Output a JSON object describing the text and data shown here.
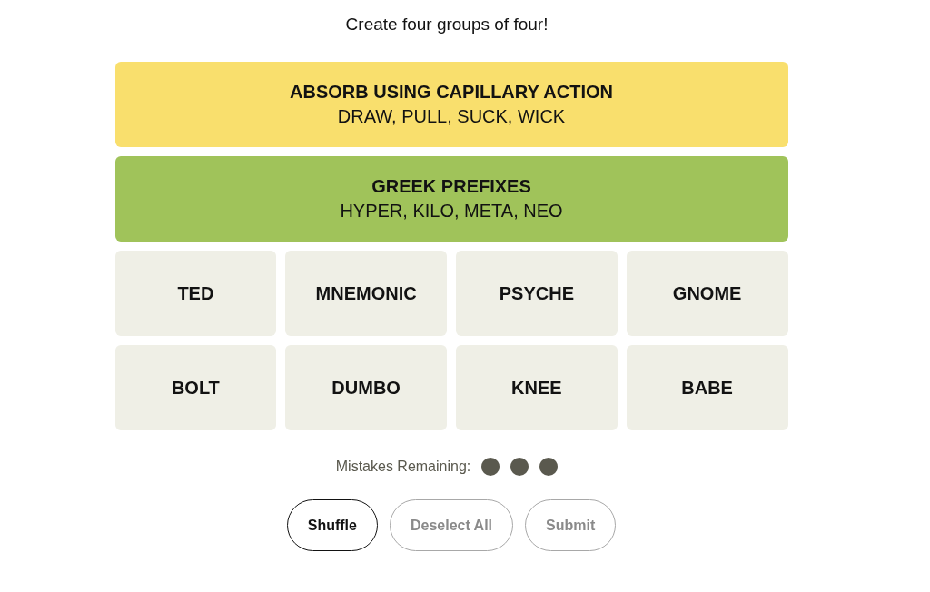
{
  "instructions": "Create four groups of four!",
  "solved_groups": [
    {
      "title": "ABSORB USING CAPILLARY ACTION",
      "members": "DRAW, PULL, SUCK, WICK",
      "color": "#f9df6d"
    },
    {
      "title": "GREEK PREFIXES",
      "members": "HYPER, KILO, META, NEO",
      "color": "#a0c35a"
    }
  ],
  "tiles": [
    {
      "word": "TED",
      "selected": false
    },
    {
      "word": "MNEMONIC",
      "selected": false
    },
    {
      "word": "PSYCHE",
      "selected": false
    },
    {
      "word": "GNOME",
      "selected": false
    },
    {
      "word": "BOLT",
      "selected": false
    },
    {
      "word": "DUMBO",
      "selected": false
    },
    {
      "word": "KNEE",
      "selected": false
    },
    {
      "word": "BABE",
      "selected": false
    }
  ],
  "mistakes": {
    "label": "Mistakes Remaining:",
    "dots": [
      {
        "used": false
      },
      {
        "used": false
      },
      {
        "used": false
      }
    ]
  },
  "buttons": [
    {
      "label": "Shuffle",
      "disabled": false
    },
    {
      "label": "Deselect All",
      "disabled": true
    },
    {
      "label": "Submit",
      "disabled": true
    }
  ]
}
